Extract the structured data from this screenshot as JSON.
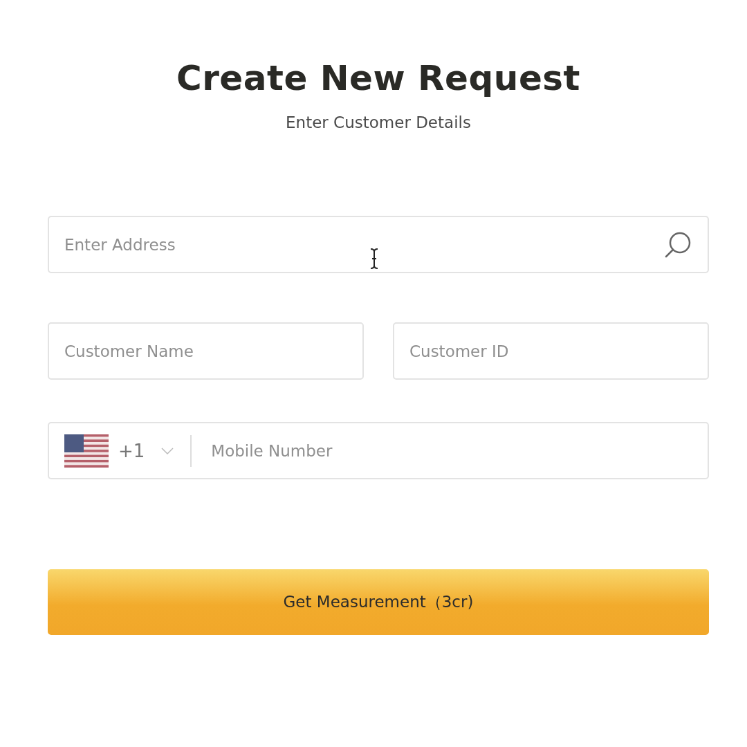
{
  "header": {
    "title": "Create New Request",
    "subtitle": "Enter Customer Details"
  },
  "address": {
    "placeholder": "Enter Address"
  },
  "customer_name": {
    "placeholder": "Customer Name"
  },
  "customer_id": {
    "placeholder": "Customer ID"
  },
  "phone": {
    "country_code": "+1",
    "placeholder": "Mobile Number"
  },
  "submit": {
    "label": "Get Measurement（3cr)"
  }
}
